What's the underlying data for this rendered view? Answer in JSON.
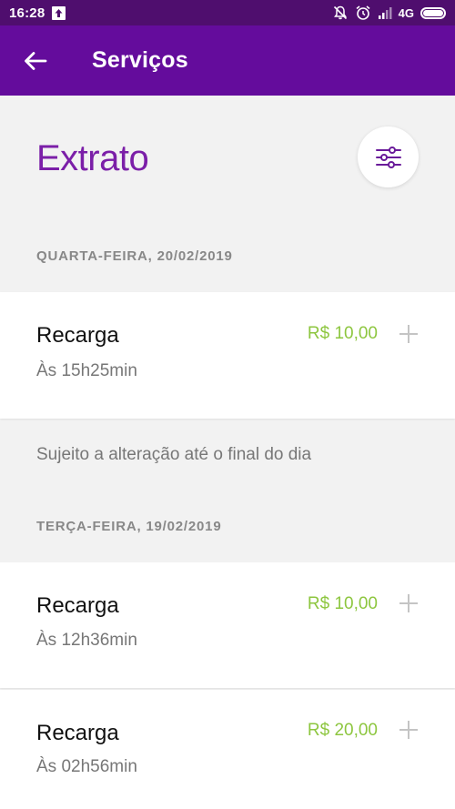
{
  "status_bar": {
    "time": "16:28",
    "network": "4G"
  },
  "app_bar": {
    "title": "Serviços"
  },
  "page": {
    "title": "Extrato"
  },
  "sections": [
    {
      "date_label": "QUARTA-FEIRA, 20/02/2019",
      "transactions": [
        {
          "title": "Recarga",
          "time": "Às 15h25min",
          "amount": "R$ 10,00"
        }
      ],
      "note": "Sujeito a alteração até o final do dia"
    },
    {
      "date_label": "TERÇA-FEIRA, 19/02/2019",
      "transactions": [
        {
          "title": "Recarga",
          "time": "Às 12h36min",
          "amount": "R$ 10,00"
        },
        {
          "title": "Recarga",
          "time": "Às 02h56min",
          "amount": "R$ 20,00"
        }
      ]
    }
  ],
  "colors": {
    "status_bar": "#4f0e6e",
    "app_bar": "#640c9c",
    "title_purple": "#7b1fa8",
    "amount_green": "#8dc63f"
  }
}
